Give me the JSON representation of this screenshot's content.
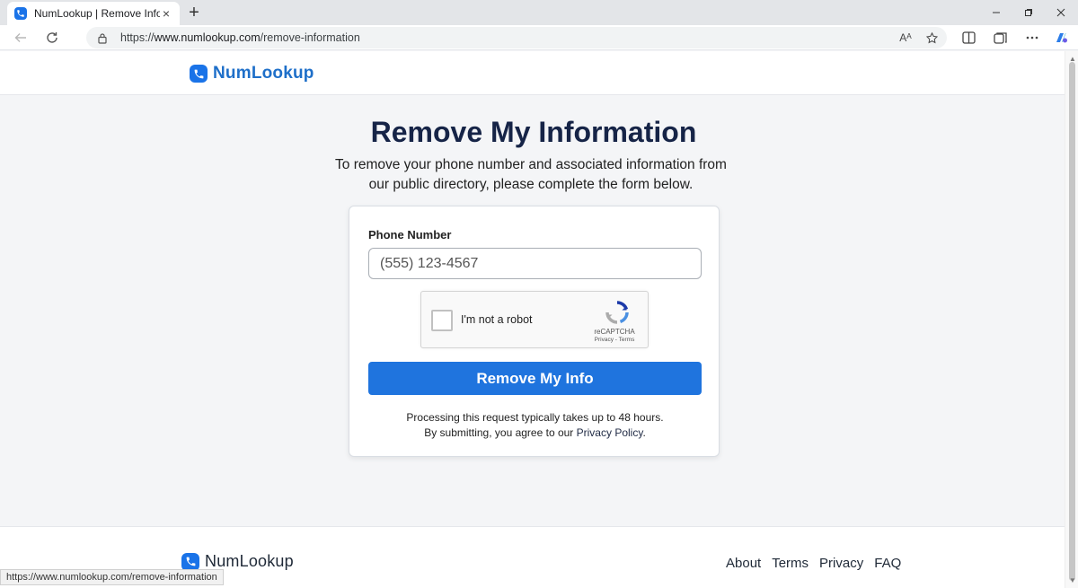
{
  "browser": {
    "tab_title": "NumLookup | Remove Info",
    "url_prefix": "https://",
    "url_domain": "www.numlookup.com",
    "url_path": "/remove-information",
    "new_tab_symbol": "+",
    "close_tab_symbol": "×",
    "read_aloud_symbol": "Aᴬ",
    "status_url": "https://www.numlookup.com/remove-information"
  },
  "header": {
    "brand": "NumLookup"
  },
  "main": {
    "title": "Remove My Information",
    "intro_line1": "To remove your phone number and associated information from",
    "intro_line2": "our public directory, please complete the form below."
  },
  "form": {
    "phone_label": "Phone Number",
    "phone_placeholder": "(555) 123-4567",
    "captcha_label": "I'm not a robot",
    "captcha_brand": "reCAPTCHA",
    "captcha_links": "Privacy - Terms",
    "submit_label": "Remove My Info",
    "note_line1": "Processing this request typically takes up to 48 hours.",
    "note_line2_prefix": "By submitting, you agree to our ",
    "note_link": "Privacy Policy",
    "note_line2_suffix": "."
  },
  "footer": {
    "brand": "NumLookup",
    "links": [
      "About",
      "Terms",
      "Privacy",
      "FAQ"
    ]
  },
  "colors": {
    "brand_blue": "#1e6fc9",
    "button_blue": "#1f74de",
    "title_navy": "#162447"
  }
}
